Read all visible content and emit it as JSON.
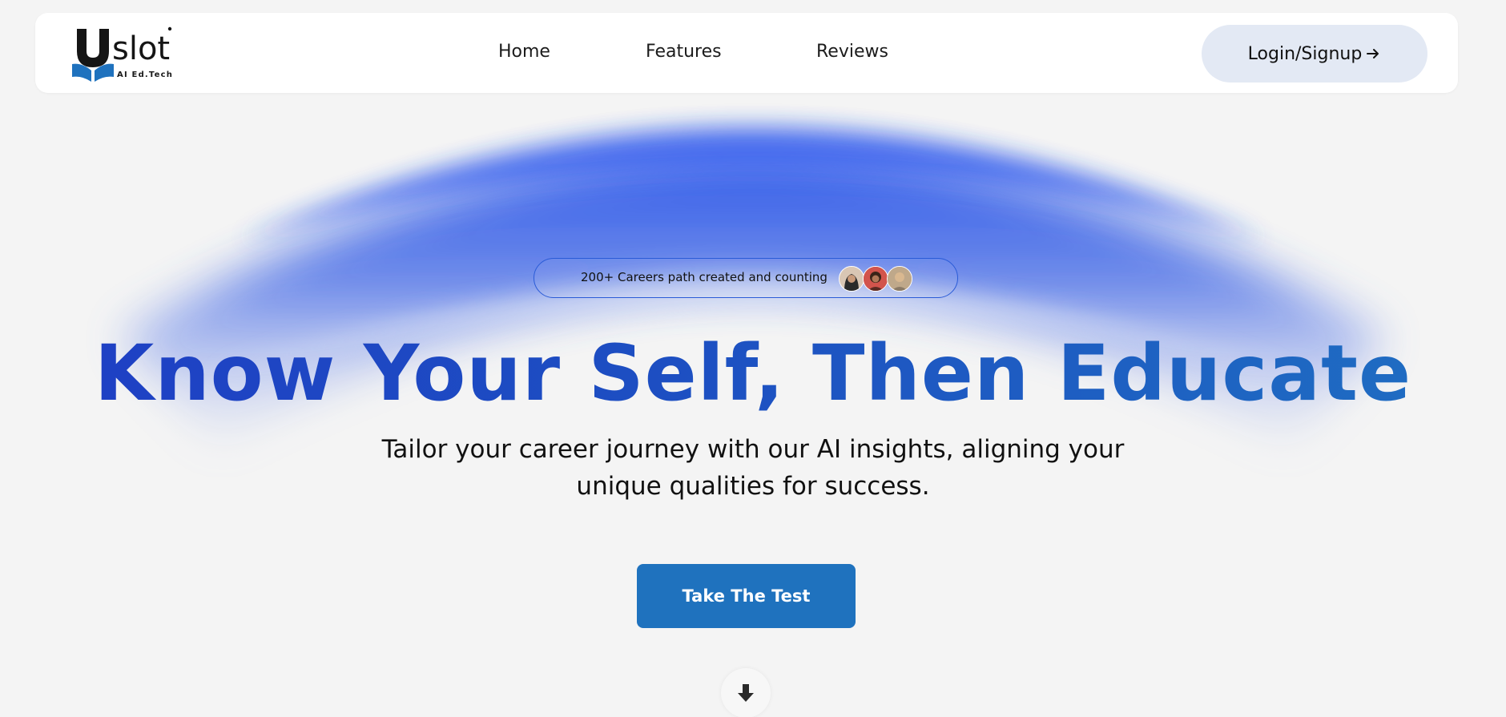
{
  "brand": {
    "name": "slot",
    "letter": "U",
    "tagline": "AI Ed.Tech",
    "accent": "#1f72be"
  },
  "nav": {
    "links": [
      "Home",
      "Features",
      "Reviews"
    ],
    "login_label": "Login/Signup",
    "login_icon": "arrow-right-icon"
  },
  "hero": {
    "pill_text": "200+ Careers path created and counting",
    "headline": "Know Your Self, Then Educate",
    "subline_1": "Tailor your career journey with our AI insights, aligning your",
    "subline_2": "unique qualities for success.",
    "cta_label": "Take The Test",
    "scroll_icon": "arrow-down-icon"
  },
  "colors": {
    "glow": "#2b54e8",
    "headline_start": "#1e3ec4",
    "headline_end": "#1f6fc2",
    "cta": "#1f72be",
    "login_bg": "#e3e9f4"
  }
}
